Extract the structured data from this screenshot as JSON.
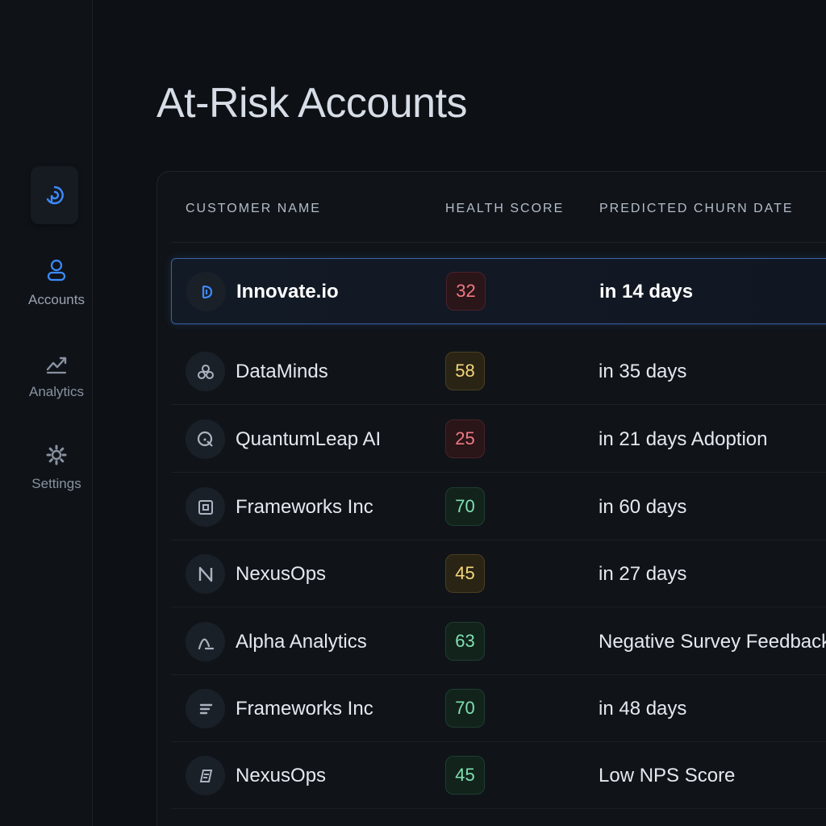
{
  "page": {
    "title": "At-Risk Accounts"
  },
  "sidebar": {
    "logo_icon": "brand-logo-icon",
    "items": [
      {
        "label": "Accounts",
        "icon": "user-icon",
        "active": true
      },
      {
        "label": "Analytics",
        "icon": "trend-chart-icon",
        "active": false
      },
      {
        "label": "Settings",
        "icon": "gear-icon",
        "active": false
      }
    ]
  },
  "table": {
    "columns": [
      "CUSTOMER NAME",
      "HEALTH SCORE",
      "PREDICTED CHURN DATE"
    ],
    "rows": [
      {
        "name": "Innovate.io",
        "score": "32",
        "status": "red",
        "churn": "in 14 days",
        "icon": "innovate-logo-icon",
        "selected": true
      },
      {
        "name": "DataMinds",
        "score": "58",
        "status": "yellow",
        "churn": "in 35 days",
        "icon": "datamindslogo-icon"
      },
      {
        "name": "QuantumLeap AI",
        "score": "25",
        "status": "red",
        "churn": "in 21 days Adoption",
        "icon": "quantumleap-logo-icon"
      },
      {
        "name": "Frameworks Inc",
        "score": "70",
        "status": "green",
        "churn": "in 60 days",
        "icon": "frameworks-logo-icon"
      },
      {
        "name": "NexusOps",
        "score": "45",
        "status": "yellow",
        "churn": "in 27 days",
        "icon": "nexusops-logo-icon"
      },
      {
        "name": "Alpha Analytics",
        "score": "63",
        "status": "green",
        "churn": "Negative Survey Feedback",
        "icon": "alpha-analytics-logo-icon"
      },
      {
        "name": "Frameworks Inc",
        "score": "70",
        "status": "green",
        "churn": "in 48 days",
        "icon": "frameworks-alt-logo-icon"
      },
      {
        "name": "NexusOps",
        "score": "45",
        "status": "green",
        "churn": "Low NPS Score",
        "icon": "nexusops-alt-logo-icon"
      }
    ]
  },
  "colors": {
    "accent": "#3d8bff",
    "red": "#f07a82",
    "yellow": "#f5d77a",
    "green": "#7fe0b0"
  }
}
